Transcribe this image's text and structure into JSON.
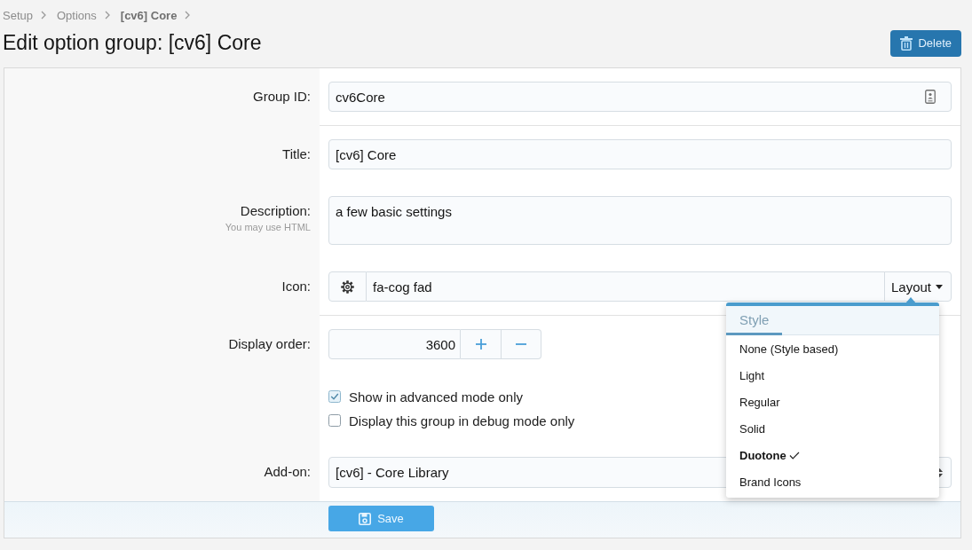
{
  "breadcrumb": [
    {
      "label": "Setup",
      "current": false
    },
    {
      "label": "Options",
      "current": false
    },
    {
      "label": "[cv6] Core",
      "current": true
    }
  ],
  "page_title": "Edit option group: [cv6] Core",
  "delete_button": {
    "label": "Delete"
  },
  "form": {
    "sections": [
      {
        "rows": [
          {
            "kind": "identifier",
            "label": "Group ID:",
            "value": "cv6Core"
          }
        ]
      },
      {
        "rows": [
          {
            "kind": "text",
            "label": "Title:",
            "value": "[cv6] Core"
          },
          {
            "kind": "textarea",
            "label": "Description:",
            "hint": "You may use HTML",
            "value": "a few basic settings"
          },
          {
            "kind": "icon",
            "label": "Icon:",
            "value": "fa-cog fad",
            "button": "Layout",
            "menu": {
              "tabs": [
                {
                  "label": "Style",
                  "selected": true
                }
              ],
              "items": [
                {
                  "label": "None (Style based)",
                  "selected": false
                },
                {
                  "label": "Light",
                  "selected": false
                },
                {
                  "label": "Regular",
                  "selected": false
                },
                {
                  "label": "Solid",
                  "selected": false
                },
                {
                  "label": "Duotone",
                  "selected": true
                },
                {
                  "label": "Brand Icons",
                  "selected": false
                }
              ]
            }
          }
        ]
      },
      {
        "rows": [
          {
            "kind": "number",
            "label": "Display order:",
            "value": "3600"
          },
          {
            "kind": "checkboxes",
            "options": [
              {
                "label": "Show in advanced mode only",
                "checked": true
              },
              {
                "label": "Display this group in debug mode only",
                "checked": false
              }
            ]
          },
          {
            "kind": "select",
            "label": "Add-on:",
            "value": "[cv6] - Core Library"
          }
        ]
      }
    ]
  },
  "save_button": {
    "label": "Save"
  }
}
